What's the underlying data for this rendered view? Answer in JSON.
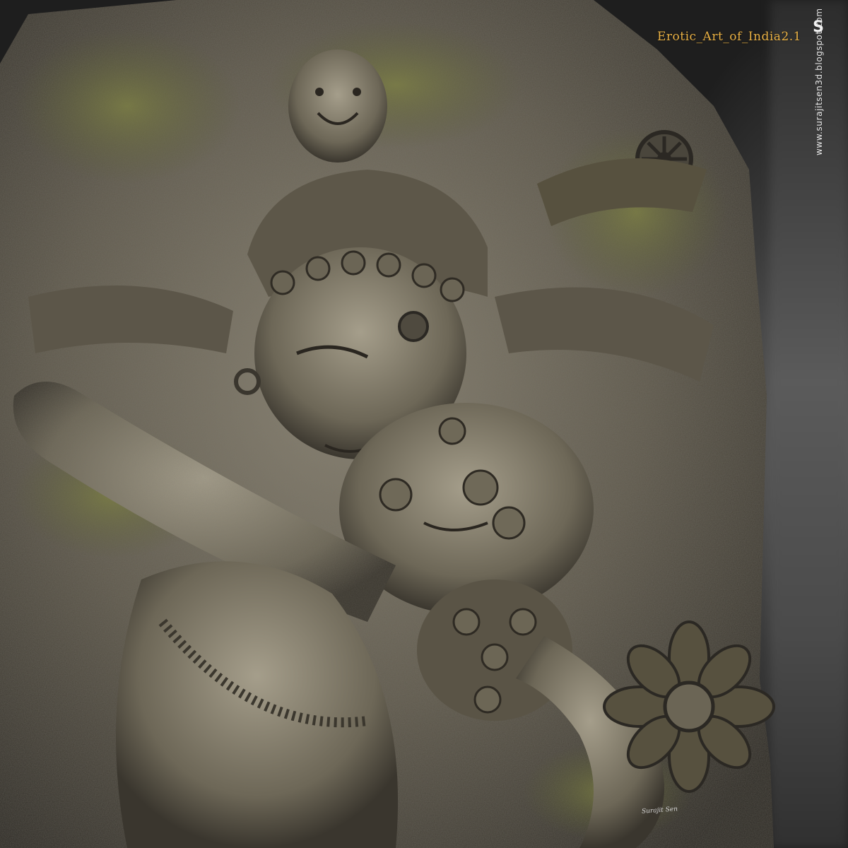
{
  "image": {
    "subject": "stone-relief-carving",
    "overlay": {
      "title": "Erotic_Art_of_India2.1",
      "logo_mark": "S",
      "url": "www.surajitsen3d.blogspot.com",
      "signature": "Surajit Sen"
    },
    "colors": {
      "title": "#e8b044",
      "stone": "#6b6558",
      "moss": "#6f7240",
      "background": "#2a2a2a"
    }
  }
}
